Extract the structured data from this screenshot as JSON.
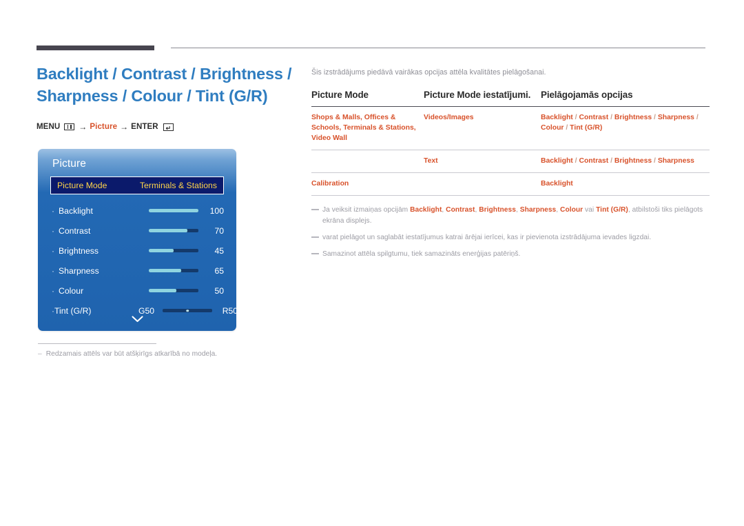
{
  "header": {
    "title_line1": "Backlight / Contrast / Brightness /",
    "title_line2": "Sharpness / Colour / Tint (G/R)",
    "menu_path": {
      "menu_label": "MENU",
      "arrow1": "→",
      "target": "Picture",
      "arrow2": "→",
      "enter_label": "ENTER",
      "grid_icon": "grid-icon",
      "enter_icon": "enter-key-icon"
    }
  },
  "osd": {
    "title": "Picture",
    "selected": {
      "label": "Picture Mode",
      "value": "Terminals & Stations"
    },
    "rows": [
      {
        "bullet": "·",
        "name": "Backlight",
        "value": "100",
        "percent": 100
      },
      {
        "bullet": "·",
        "name": "Contrast",
        "value": "70",
        "percent": 78
      },
      {
        "bullet": "·",
        "name": "Brightness",
        "value": "45",
        "percent": 50
      },
      {
        "bullet": "·",
        "name": "Sharpness",
        "value": "65",
        "percent": 65
      },
      {
        "bullet": "·",
        "name": "Colour",
        "value": "50",
        "percent": 55
      }
    ],
    "tint": {
      "bullet": "·",
      "name": "Tint (G/R)",
      "left": "G50",
      "right": "R50"
    },
    "scroll_icon": "chevron-down-icon"
  },
  "left_note": {
    "dash": "–",
    "text": "Redzamais attēls var būt atšķirīgs atkarībā no modeļa."
  },
  "main": {
    "intro": "Šis izstrādājums piedāvā vairākas opcijas attēla kvalitātes pielāgošanai.",
    "table": {
      "headers": [
        "Picture Mode",
        "Picture Mode iestatījumi.",
        "Pielāgojamās opcijas"
      ],
      "rows": [
        {
          "c1": "Shops & Malls, Offices & Schools, Terminals & Stations, Video Wall",
          "c2": "Videos/Images",
          "c3": "Backlight / Contrast / Brightness / Sharpness / Colour / Tint (G/R)"
        },
        {
          "c1": "",
          "c2": "Text",
          "c3": "Backlight / Contrast / Brightness / Sharpness"
        },
        {
          "c1": "Calibration",
          "c2": "",
          "c3": "Backlight"
        }
      ]
    },
    "notes": [
      {
        "pre": "Ja veiksit izmaiņas opcijām ",
        "b1": "Backlight",
        "s1": ", ",
        "b2": "Contrast",
        "s2": ", ",
        "b3": "Brightness",
        "s3": ", ",
        "b4": "Sharpness",
        "s4": ", ",
        "b5": "Colour",
        "s5": " vai ",
        "b6": "Tint (G/R)",
        "post": ", atbilstoši tiks pielāgots ekrāna displejs."
      },
      {
        "text": "varat pielāgot un saglabāt iestatījumus katrai ārējai ierīcei, kas ir pievienota izstrādājuma ievades ligzdai."
      },
      {
        "text": "Samazinot attēla spilgtumu, tiek samazināts enerģijas patēriņš."
      }
    ]
  },
  "colors": {
    "title_blue": "#2f7dc0",
    "accent_orange": "#d8522b",
    "osd_blue": "#1f63ae",
    "osd_selected_bg": "#0b1a6b",
    "osd_selected_text": "#ffd54a",
    "slider_fill": "#8fd4e0",
    "slider_track": "#143a6b",
    "muted_gray": "#9b9ba3"
  }
}
